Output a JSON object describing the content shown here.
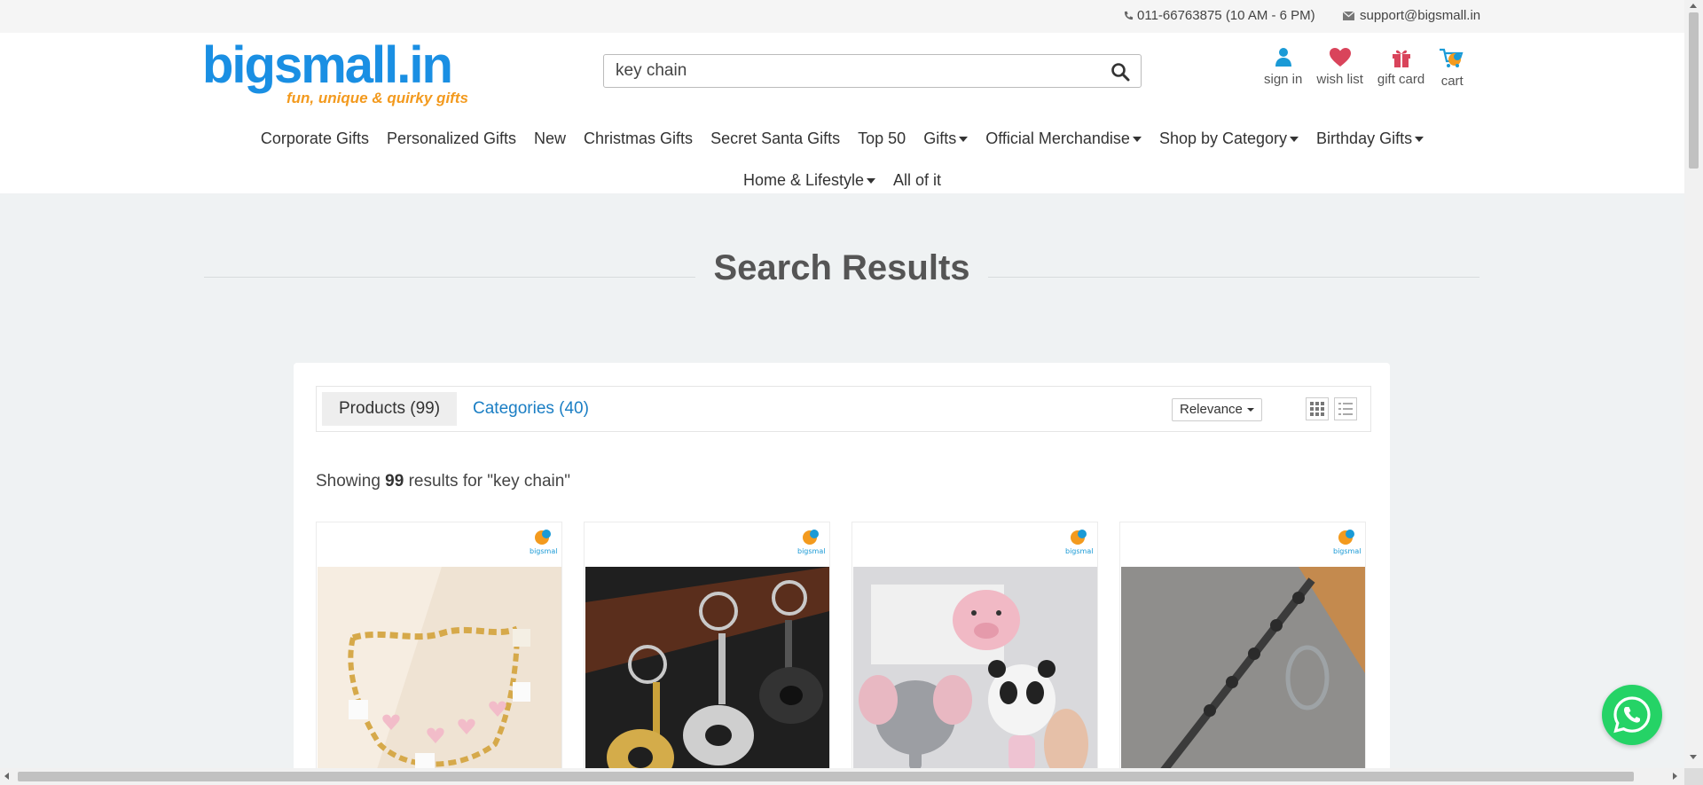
{
  "topbar": {
    "phone": "011-66763875 (10 AM - 6 PM)",
    "email": "support@bigsmall.in"
  },
  "logo": {
    "main": "bigsmall.in",
    "tagline": "fun, unique & quirky gifts"
  },
  "search": {
    "value": "key chain",
    "icon": "search-icon"
  },
  "header_icons": [
    {
      "label": "sign in",
      "icon": "user-icon",
      "color": "#1a9ad6"
    },
    {
      "label": "wish list",
      "icon": "heart-icon",
      "color": "#d9445b"
    },
    {
      "label": "gift card",
      "icon": "gift-icon",
      "color": "#d9445b"
    },
    {
      "label": "cart",
      "icon": "cart-icon",
      "color": "#1a9ad6"
    }
  ],
  "nav": {
    "row1": [
      {
        "label": "Corporate Gifts",
        "dropdown": false
      },
      {
        "label": "Personalized Gifts",
        "dropdown": false
      },
      {
        "label": "New",
        "dropdown": false
      },
      {
        "label": "Christmas Gifts",
        "dropdown": false
      },
      {
        "label": "Secret Santa Gifts",
        "dropdown": false
      },
      {
        "label": "Top 50",
        "dropdown": false
      },
      {
        "label": "Gifts",
        "dropdown": true
      },
      {
        "label": "Official Merchandise",
        "dropdown": true
      },
      {
        "label": "Shop by Category",
        "dropdown": true
      },
      {
        "label": "Birthday Gifts",
        "dropdown": true
      }
    ],
    "row2": [
      {
        "label": "Home & Lifestyle",
        "dropdown": true
      },
      {
        "label": "All of it",
        "dropdown": false
      }
    ]
  },
  "page_title": "Search Results",
  "tabs": {
    "products": "Products (99)",
    "categories": "Categories (40)"
  },
  "sort": {
    "selected": "Relevance"
  },
  "results": {
    "prefix": "Showing",
    "count": "99",
    "suffix": "results for \"key chain\""
  },
  "products": [
    {
      "image": "charm-bracelet-keychain"
    },
    {
      "image": "pan-bottle-opener-keychain"
    },
    {
      "image": "plush-animal-keychain"
    },
    {
      "image": "wand-keychain"
    }
  ],
  "colors": {
    "accent": "#1a7ec4",
    "logo_blue": "#1a8fe3",
    "logo_orange": "#f39a1e",
    "whatsapp": "#25d366"
  }
}
